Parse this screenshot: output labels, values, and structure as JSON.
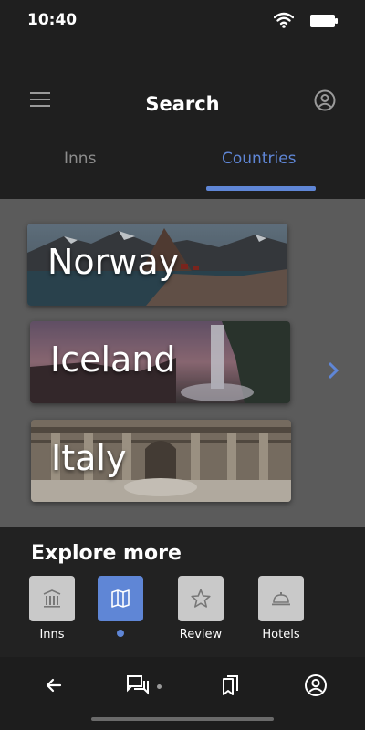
{
  "status_bar": {
    "time": "10:40",
    "icons": [
      "wifi-icon",
      "battery-icon"
    ]
  },
  "header": {
    "title": "Search",
    "menu_icon": "menu-icon",
    "account_icon": "account-icon"
  },
  "tabs": [
    {
      "label": "Inns",
      "active": false
    },
    {
      "label": "Countries",
      "active": true
    }
  ],
  "countries": [
    {
      "name": "Norway"
    },
    {
      "name": "Iceland"
    },
    {
      "name": "Italy"
    }
  ],
  "explore": {
    "title": "Explore more",
    "items": [
      {
        "label": "Inns",
        "icon": "building-icon",
        "active": false
      },
      {
        "label": "",
        "icon": "map-icon",
        "active": true
      },
      {
        "label": "Review",
        "icon": "star-icon",
        "active": false
      },
      {
        "label": "Hotels",
        "icon": "room-service-icon",
        "active": false
      }
    ]
  },
  "bottom_nav": {
    "icons": [
      "back-arrow-icon",
      "chat-icon",
      "bookmark-icon",
      "account-icon"
    ]
  },
  "colors": {
    "accent": "#5f86d6",
    "background": "#1f1f1f",
    "content_background": "#5b5b5b"
  }
}
